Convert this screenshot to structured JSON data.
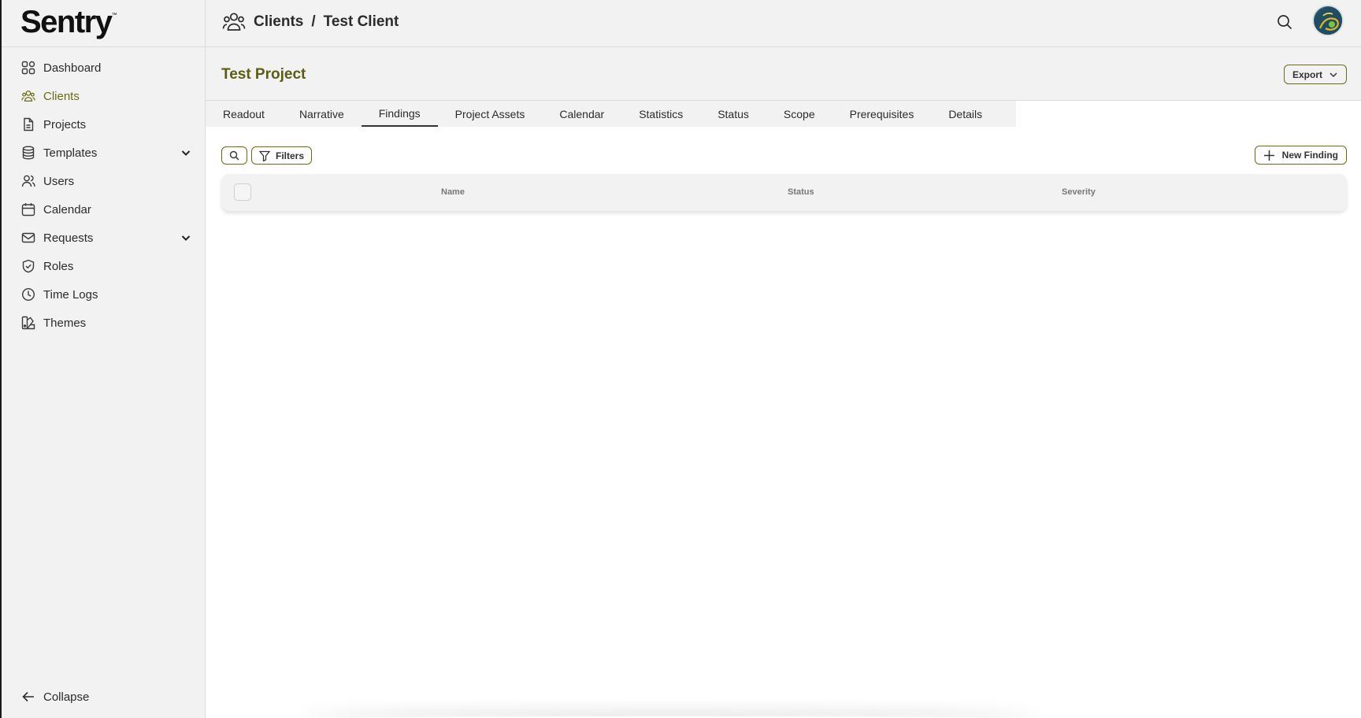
{
  "brand": {
    "logo_text": "Sentry",
    "trademark": "™"
  },
  "sidebar": {
    "items": [
      {
        "label": "Dashboard",
        "icon": "grid-icon"
      },
      {
        "label": "Clients",
        "icon": "users-icon",
        "active": true
      },
      {
        "label": "Projects",
        "icon": "document-icon"
      },
      {
        "label": "Templates",
        "icon": "database-icon",
        "expandable": true
      },
      {
        "label": "Users",
        "icon": "user-group-icon"
      },
      {
        "label": "Calendar",
        "icon": "calendar-icon"
      },
      {
        "label": "Requests",
        "icon": "mail-icon",
        "expandable": true
      },
      {
        "label": "Roles",
        "icon": "shield-icon"
      },
      {
        "label": "Time Logs",
        "icon": "clock-icon"
      },
      {
        "label": "Themes",
        "icon": "palette-icon"
      }
    ],
    "collapse_label": "Collapse"
  },
  "header": {
    "breadcrumb": [
      "Clients",
      "Test Client"
    ],
    "separator": "/"
  },
  "project": {
    "title": "Test Project",
    "export_label": "Export"
  },
  "tabs": [
    "Readout",
    "Narrative",
    "Findings",
    "Project Assets",
    "Calendar",
    "Statistics",
    "Status",
    "Scope",
    "Prerequisites",
    "Details"
  ],
  "active_tab": "Findings",
  "toolbar": {
    "filters_label": "Filters",
    "new_finding_label": "New Finding"
  },
  "table": {
    "columns": [
      "Name",
      "Status",
      "Severity"
    ]
  },
  "colors": {
    "accent": "#6b6b12",
    "title": "#5c5c14",
    "background": "#f2f2f2"
  }
}
